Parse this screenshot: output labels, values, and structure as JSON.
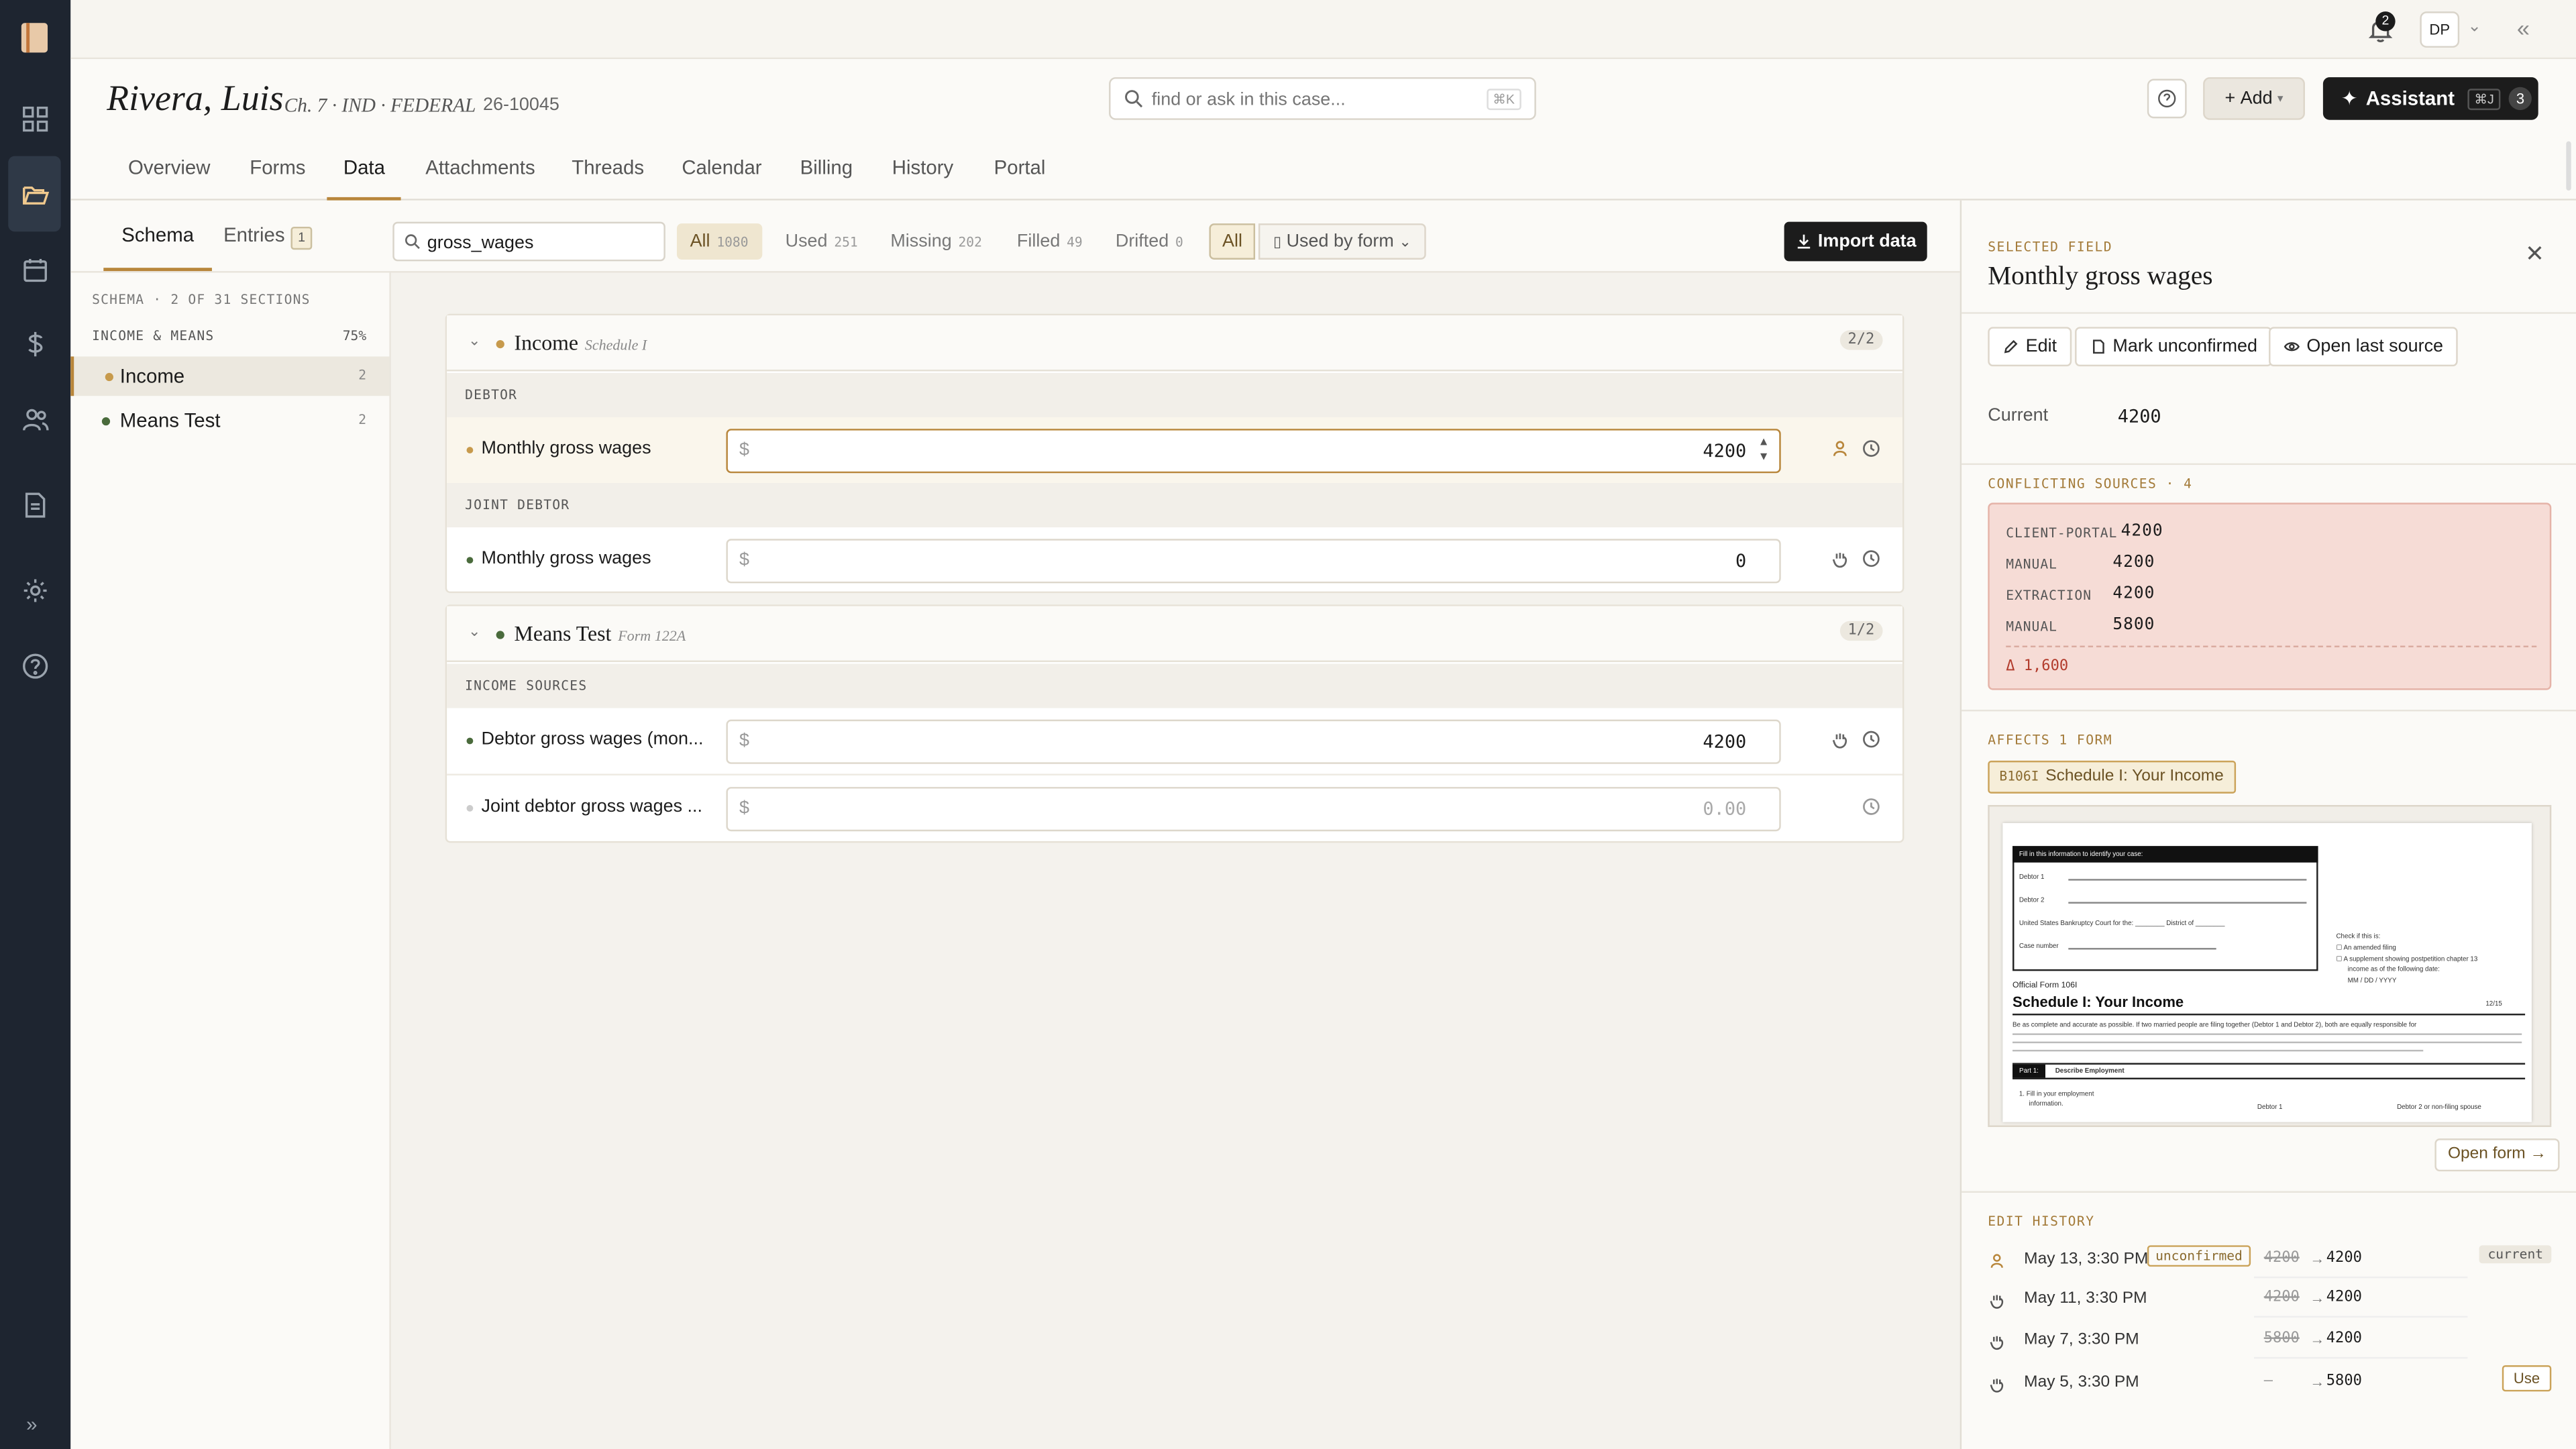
{
  "nav": {
    "items": [
      {
        "name": "dashboard-icon"
      },
      {
        "name": "folder-open-icon",
        "active": true
      },
      {
        "name": "calendar-icon"
      },
      {
        "name": "dollar-icon"
      },
      {
        "name": "users-icon"
      },
      {
        "name": "document-icon"
      },
      {
        "name": "gear-icon"
      },
      {
        "name": "help-circle-icon"
      }
    ],
    "expand_label": "»"
  },
  "topbar": {
    "notifications_count": "2",
    "avatar_initials": "DP"
  },
  "case": {
    "client_name": "Rivera, Luis",
    "meta": "Ch. 7 · IND · FEDERAL",
    "case_number": "26-10045",
    "search_placeholder": "find or ask in this case...",
    "search_shortcut": "⌘K",
    "add_label": "Add",
    "assistant_label": "Assistant",
    "assistant_shortcut": "⌘J",
    "assistant_count": "3"
  },
  "tabs": [
    "Overview",
    "Forms",
    "Data",
    "Attachments",
    "Threads",
    "Calendar",
    "Billing",
    "History",
    "Portal"
  ],
  "active_tab": "Data",
  "subbar": {
    "schema_label": "Schema",
    "entries_label": "Entries",
    "entries_count": "1",
    "search_value": "gross_wages",
    "filters": [
      {
        "label": "All",
        "count": "1080",
        "active": true
      },
      {
        "label": "Used",
        "count": "251"
      },
      {
        "label": "Missing",
        "count": "202"
      },
      {
        "label": "Filled",
        "count": "49"
      },
      {
        "label": "Drifted",
        "count": "0"
      }
    ],
    "scope_all": "All",
    "used_by_form": "Used by form",
    "import_label": "Import data"
  },
  "schema": {
    "meta": "SCHEMA · 2 OF 31 SECTIONS",
    "group": "INCOME & MEANS",
    "group_pct": "75%",
    "items": [
      {
        "label": "Income",
        "count": "2",
        "active": true
      },
      {
        "label": "Means Test",
        "count": "2"
      }
    ]
  },
  "sections": [
    {
      "name": "Income",
      "sub": "Schedule I",
      "ratio": "2/2",
      "dot_color": "#c79a4c",
      "groups": [
        {
          "label": "DEBTOR",
          "fields": [
            {
              "label": "Monthly gross wages",
              "value": "4200",
              "dot": "#c79a4c",
              "selected": true
            }
          ]
        },
        {
          "label": "JOINT DEBTOR",
          "fields": [
            {
              "label": "Monthly gross wages",
              "value": "0",
              "dot": "#4a6b3c"
            }
          ]
        }
      ]
    },
    {
      "name": "Means Test",
      "sub": "Form 122A",
      "ratio": "1/2",
      "dot_color": "#4a6b3c",
      "groups": [
        {
          "label": "INCOME SOURCES",
          "fields": [
            {
              "label": "Debtor gross wages (mon...",
              "value": "4200",
              "dot": "#4a6b3c"
            },
            {
              "label": "Joint debtor gross wages ...",
              "value": "0.00",
              "placeholder": true,
              "dot": "#cccccc"
            }
          ]
        }
      ]
    }
  ],
  "currency_symbol": "$",
  "panel": {
    "kicker": "SELECTED FIELD",
    "title": "Monthly gross wages",
    "edit_label": "Edit",
    "mark_label": "Mark unconfirmed",
    "open_source_label": "Open last source",
    "current_label": "Current",
    "current_value": "4200",
    "conflicts_label": "CONFLICTING SOURCES · 4",
    "conflicts": [
      {
        "source": "CLIENT-PORTAL",
        "value": "4200"
      },
      {
        "source": "MANUAL",
        "value": "4200"
      },
      {
        "source": "EXTRACTION",
        "value": "4200"
      },
      {
        "source": "MANUAL",
        "value": "5800"
      }
    ],
    "delta": "Δ 1,600",
    "affects_label": "AFFECTS 1 FORM",
    "form_code": "B106I",
    "form_name": "Schedule I: Your Income",
    "preview": {
      "header": "Fill in this information to identify your case:",
      "debtor1": "Debtor 1",
      "debtor2": "Debtor 2",
      "court": "United States Bankruptcy Court for the: ________ District of ________",
      "case_number": "Case number",
      "official": "Official Form 106I",
      "title": "Schedule I: Your Income",
      "check": "Check if this is:",
      "amended": "An amended filing",
      "supplement": "A supplement showing postpetition chapter 13",
      "income_date": "income as of the following date:",
      "date_fmt": "MM / DD / YYYY",
      "date_code": "12/15",
      "instr": "Be as complete and accurate as possible. If two married people are filing together (Debtor 1 and Debtor 2), both are equally responsible for",
      "part": "Part 1:",
      "part_title": "Describe Employment",
      "fill": "1. Fill in your employment",
      "information": "information.",
      "col1": "Debtor 1",
      "col2": "Debtor 2 or non-filing spouse"
    },
    "open_form_label": "Open form →",
    "history_label": "EDIT HISTORY",
    "history": [
      {
        "icon": "person-icon",
        "date": "May 13, 3:30 PM",
        "tag": "unconfirmed",
        "old": "4200",
        "new": "4200",
        "status": "current"
      },
      {
        "icon": "hand-icon",
        "date": "May 11, 3:30 PM",
        "old": "4200",
        "new": "4200"
      },
      {
        "icon": "hand-icon",
        "date": "May 7, 3:30 PM",
        "old": "5800",
        "new": "4200"
      },
      {
        "icon": "hand-icon",
        "date": "May 5, 3:30 PM",
        "old": "—",
        "new": "5800",
        "action": "Use"
      }
    ]
  }
}
